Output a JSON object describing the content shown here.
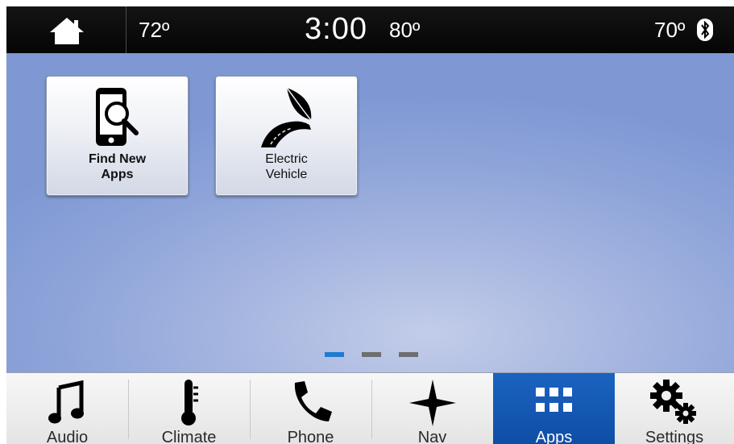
{
  "status_bar": {
    "temp_left": "72º",
    "clock": "3:00",
    "temp_outside": "80º",
    "temp_right": "70º",
    "home_icon": "home-icon",
    "bluetooth_icon": "bluetooth-icon"
  },
  "apps": [
    {
      "label_line1": "Find New",
      "label_line2": "Apps",
      "icon": "phone-search-icon"
    },
    {
      "label_line1": "Electric",
      "label_line2": "Vehicle",
      "icon": "leaf-road-icon"
    }
  ],
  "page_indicator": {
    "pages": 3,
    "active_page": 1
  },
  "nav": {
    "items": [
      {
        "label": "Audio",
        "icon": "music-note-icon"
      },
      {
        "label": "Climate",
        "icon": "thermometer-icon"
      },
      {
        "label": "Phone",
        "icon": "phone-handset-icon"
      },
      {
        "label": "Nav",
        "icon": "compass-star-icon"
      },
      {
        "label": "Apps",
        "icon": "apps-grid-icon"
      },
      {
        "label": "Settings",
        "icon": "gears-icon"
      }
    ],
    "active": "Apps"
  },
  "colors": {
    "accent": "#1b63c0",
    "active_page_dot": "#1e7bd0",
    "inactive_page_dot": "#6d6e70",
    "status_bar": "#0b0b0b"
  }
}
